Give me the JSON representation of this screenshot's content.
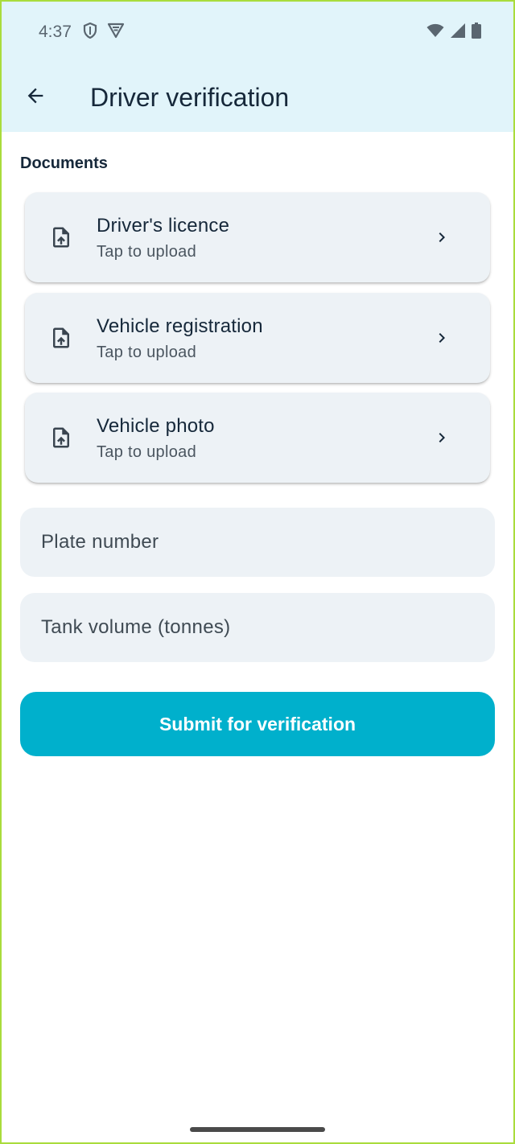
{
  "status_bar": {
    "time": "4:37",
    "left_icons": [
      "shield-icon",
      "vpn-badge-icon"
    ],
    "right_icons": [
      "wifi-icon",
      "signal-icon",
      "battery-icon"
    ]
  },
  "app_bar": {
    "back_icon": "arrow-back-icon",
    "title": "Driver verification"
  },
  "documents": {
    "section_label": "Documents",
    "items": [
      {
        "title": "Driver's licence",
        "subtitle": "Tap to upload",
        "icon": "file-upload-icon"
      },
      {
        "title": "Vehicle registration",
        "subtitle": "Tap to upload",
        "icon": "file-upload-icon"
      },
      {
        "title": "Vehicle photo",
        "subtitle": "Tap to upload",
        "icon": "file-upload-icon"
      }
    ]
  },
  "form": {
    "plate_placeholder": "Plate number",
    "tank_placeholder": "Tank volume (tonnes)"
  },
  "submit_label": "Submit for verification",
  "colors": {
    "app_bar_bg": "#e1f4fa",
    "card_bg": "#edf2f6",
    "accent": "#00b0cc",
    "frame_border": "#a9dc3c"
  }
}
